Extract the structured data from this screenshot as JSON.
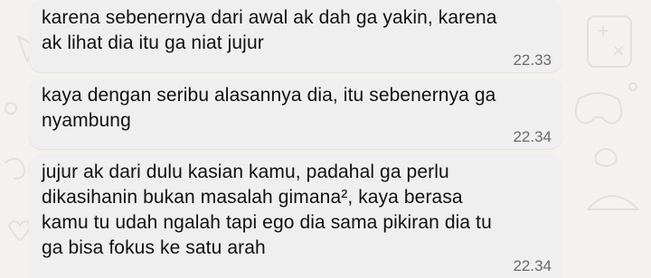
{
  "messages": [
    {
      "lines": [
        "karena sebenernya dari awal ak dah ga yakin, karena",
        "ak lihat dia itu ga niat jujur"
      ],
      "time": "22.33"
    },
    {
      "lines": [
        "kaya dengan seribu alasannya dia, itu sebenernya ga",
        "nyambung"
      ],
      "time": "22.34"
    },
    {
      "lines": [
        "jujur ak dari dulu kasian kamu, padahal ga perlu",
        "dikasihanin bukan masalah gimana², kaya berasa",
        "kamu tu udah ngalah tapi ego dia sama pikiran dia tu",
        "ga bisa fokus ke satu arah"
      ],
      "time": "22.34"
    }
  ],
  "colors": {
    "background": "#f4f2ef",
    "bubble": "#f0efef",
    "text": "#111111",
    "time": "#6b6b6b",
    "doodle": "#e3e0dc"
  }
}
